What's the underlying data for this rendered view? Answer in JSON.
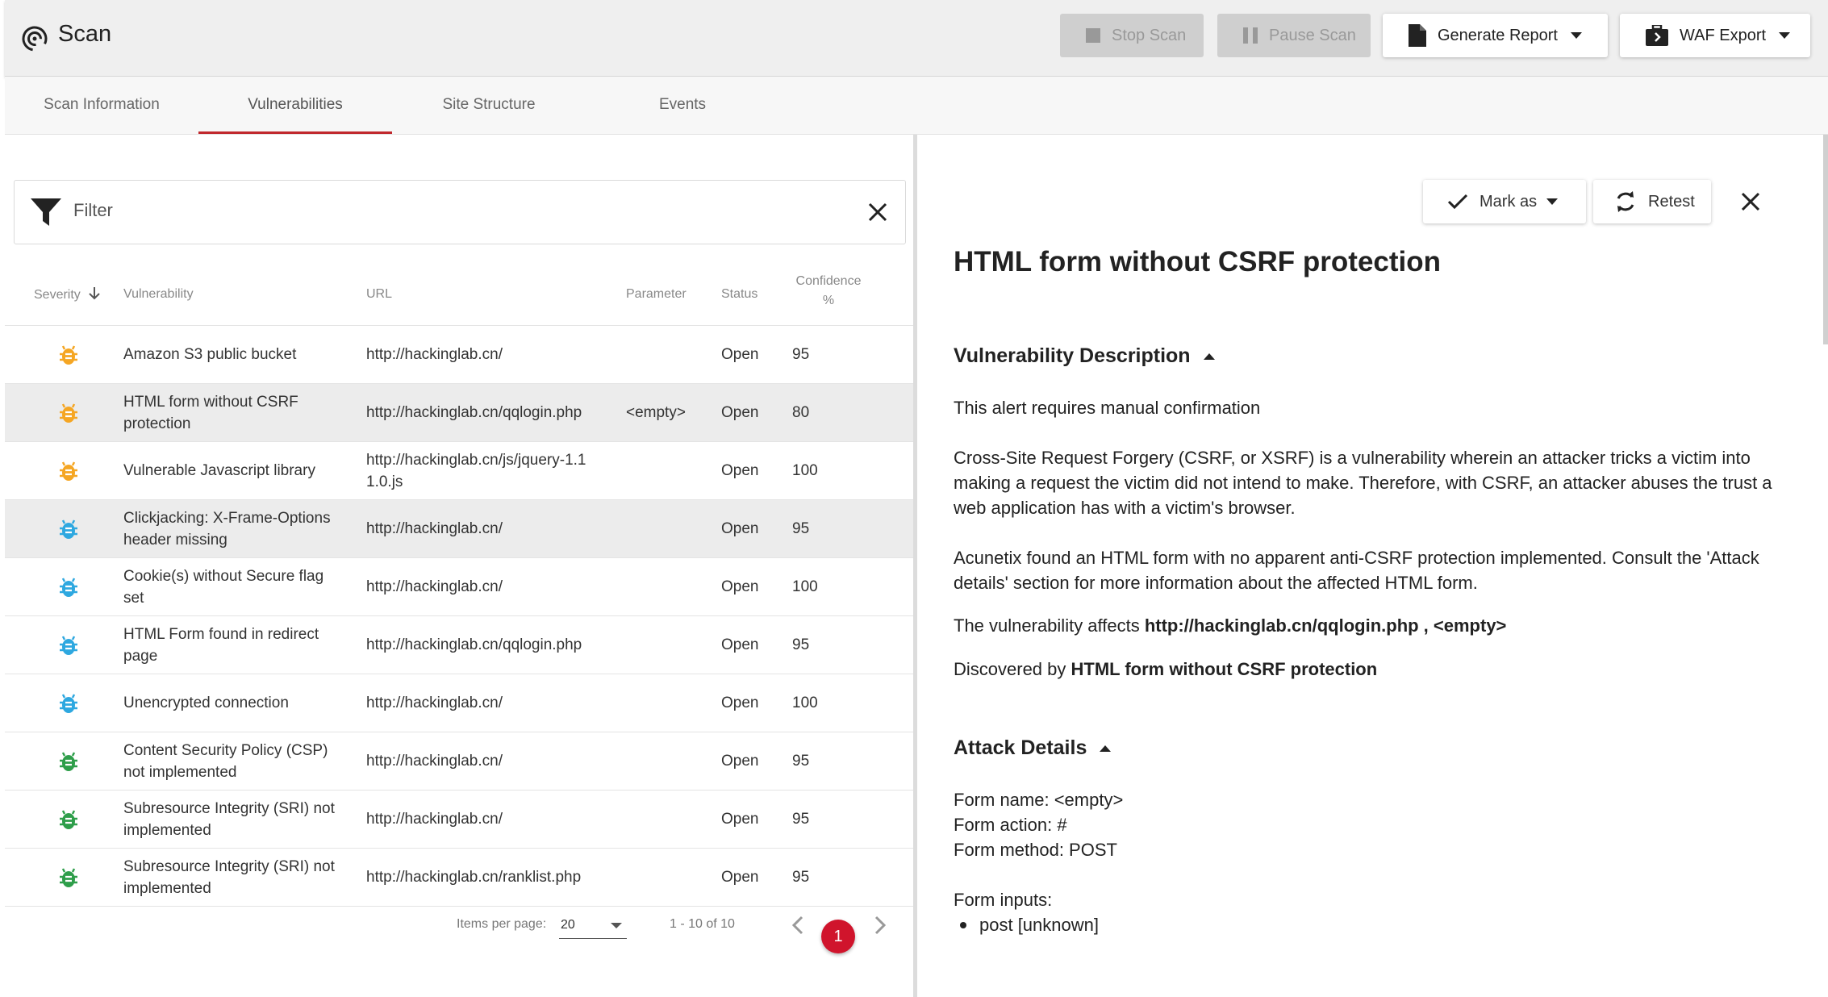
{
  "header": {
    "title": "Scan",
    "buttons": {
      "stop": "Stop Scan",
      "pause": "Pause Scan",
      "report": "Generate Report",
      "waf": "WAF Export"
    }
  },
  "tabs": [
    {
      "label": "Scan Information"
    },
    {
      "label": "Vulnerabilities"
    },
    {
      "label": "Site Structure"
    },
    {
      "label": "Events"
    }
  ],
  "filter": {
    "label": "Filter"
  },
  "columns": {
    "severity": "Severity",
    "vulnerability": "Vulnerability",
    "url": "URL",
    "parameter": "Parameter",
    "status": "Status",
    "confidence_1": "Confidence",
    "confidence_2": "%"
  },
  "rows": [
    {
      "severity": "medium",
      "name_1": "Amazon S3 public bucket",
      "name_2": "",
      "url_1": "http://hackinglab.cn/",
      "url_2": "",
      "param": "",
      "status": "Open",
      "confidence": "95"
    },
    {
      "severity": "medium",
      "name_1": "HTML form without CSRF",
      "name_2": "protection",
      "url_1": "http://hackinglab.cn/qqlogin.php",
      "url_2": "",
      "param": "<empty>",
      "status": "Open",
      "confidence": "80"
    },
    {
      "severity": "medium",
      "name_1": "Vulnerable Javascript library",
      "name_2": "",
      "url_1": "http://hackinglab.cn/js/jquery-1.1",
      "url_2": "1.0.js",
      "param": "",
      "status": "Open",
      "confidence": "100"
    },
    {
      "severity": "low",
      "name_1": "Clickjacking: X-Frame-Options",
      "name_2": "header missing",
      "url_1": "http://hackinglab.cn/",
      "url_2": "",
      "param": "",
      "status": "Open",
      "confidence": "95"
    },
    {
      "severity": "low",
      "name_1": "Cookie(s) without Secure flag",
      "name_2": "set",
      "url_1": "http://hackinglab.cn/",
      "url_2": "",
      "param": "",
      "status": "Open",
      "confidence": "100"
    },
    {
      "severity": "low",
      "name_1": "HTML Form found in redirect",
      "name_2": "page",
      "url_1": "http://hackinglab.cn/qqlogin.php",
      "url_2": "",
      "param": "",
      "status": "Open",
      "confidence": "95"
    },
    {
      "severity": "low",
      "name_1": "Unencrypted connection",
      "name_2": "",
      "url_1": "http://hackinglab.cn/",
      "url_2": "",
      "param": "",
      "status": "Open",
      "confidence": "100"
    },
    {
      "severity": "info",
      "name_1": "Content Security Policy (CSP)",
      "name_2": "not implemented",
      "url_1": "http://hackinglab.cn/",
      "url_2": "",
      "param": "",
      "status": "Open",
      "confidence": "95"
    },
    {
      "severity": "info",
      "name_1": "Subresource Integrity (SRI) not",
      "name_2": "implemented",
      "url_1": "http://hackinglab.cn/",
      "url_2": "",
      "param": "",
      "status": "Open",
      "confidence": "95"
    },
    {
      "severity": "info",
      "name_1": "Subresource Integrity (SRI) not",
      "name_2": "implemented",
      "url_1": "http://hackinglab.cn/ranklist.php",
      "url_2": "",
      "param": "",
      "status": "Open",
      "confidence": "95"
    }
  ],
  "pagination": {
    "items_per_page_label": "Items per page:",
    "items_per_page": "20",
    "range": "1 - 10 of 10",
    "page": "1"
  },
  "detail": {
    "mark_as": "Mark as",
    "retest": "Retest",
    "title": "HTML form without CSRF protection",
    "desc_heading": "Vulnerability Description",
    "p1": "This alert requires manual confirmation",
    "p2": "Cross-Site Request Forgery (CSRF, or XSRF) is a vulnerability wherein an attacker tricks a victim into making a request the victim did not intend to make. Therefore, with CSRF, an attacker abuses the trust a web application has with a victim's browser.",
    "p3": "Acunetix found an HTML form with no apparent anti-CSRF protection implemented. Consult the 'Attack details' section for more information about the affected HTML form.",
    "affects_prefix": "The vulnerability affects ",
    "affects_value": "http://hackinglab.cn/qqlogin.php , <empty>",
    "discovered_prefix": "Discovered by ",
    "discovered_value": "HTML form without CSRF protection",
    "attack_heading": "Attack Details",
    "form_name": "Form name: <empty>",
    "form_action": "Form action: #",
    "form_method": "Form method: POST",
    "form_inputs": "Form inputs:",
    "input_1": "post [unknown]"
  },
  "colors": {
    "medium": "#f5a623",
    "low": "#2ea8e0",
    "info": "#2e9e4a",
    "accent": "#c0282d",
    "page_badge": "#d0142c"
  }
}
